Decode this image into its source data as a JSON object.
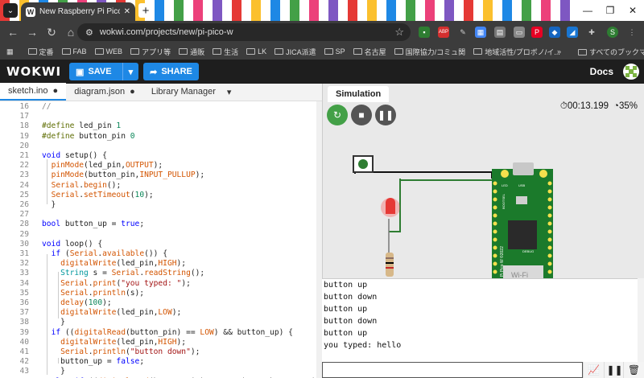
{
  "browser": {
    "tab_title": "New Raspberry Pi Pico W Project",
    "url": "wokwi.com/projects/new/pi-pico-w",
    "bookmarks": [
      "定番",
      "FAB",
      "WEB",
      "アプリ等",
      "通販",
      "生活",
      "LK",
      "JICA派遣",
      "SP",
      "名古屋",
      "国際協力/コミュ関",
      "地域活性/プロボノ/イ..."
    ],
    "bookmarks_more": "»",
    "all_bookmarks": "すべてのブックマーク"
  },
  "wokwi": {
    "logo": "WOKWI",
    "save_label": "SAVE",
    "share_label": "SHARE",
    "docs_label": "Docs"
  },
  "editor": {
    "tabs": [
      "sketch.ino",
      "diagram.json",
      "Library Manager"
    ],
    "lines": [
      {
        "n": "16",
        "t": "//"
      },
      {
        "n": "17",
        "t": ""
      },
      {
        "n": "18",
        "t": "#define led_pin 1"
      },
      {
        "n": "19",
        "t": "#define button_pin 0"
      },
      {
        "n": "20",
        "t": ""
      },
      {
        "n": "21",
        "t": "void setup() {"
      },
      {
        "n": "22",
        "t": "  pinMode(led_pin,OUTPUT);"
      },
      {
        "n": "23",
        "t": "  pinMode(button_pin,INPUT_PULLUP);"
      },
      {
        "n": "24",
        "t": "  Serial.begin();"
      },
      {
        "n": "25",
        "t": "  Serial.setTimeout(10);"
      },
      {
        "n": "26",
        "t": "  }"
      },
      {
        "n": "27",
        "t": ""
      },
      {
        "n": "28",
        "t": "bool button_up = true;"
      },
      {
        "n": "29",
        "t": ""
      },
      {
        "n": "30",
        "t": "void loop() {"
      },
      {
        "n": "31",
        "t": "  if (Serial.available()) {"
      },
      {
        "n": "32",
        "t": "    digitalWrite(led_pin,HIGH);"
      },
      {
        "n": "33",
        "t": "    String s = Serial.readString();"
      },
      {
        "n": "34",
        "t": "    Serial.print(\"you typed: \");"
      },
      {
        "n": "35",
        "t": "    Serial.println(s);"
      },
      {
        "n": "36",
        "t": "    delay(100);"
      },
      {
        "n": "37",
        "t": "    digitalWrite(led_pin,LOW);"
      },
      {
        "n": "38",
        "t": "    }"
      },
      {
        "n": "39",
        "t": "  if ((digitalRead(button_pin) == LOW) && button_up) {"
      },
      {
        "n": "40",
        "t": "    digitalWrite(led_pin,HIGH);"
      },
      {
        "n": "41",
        "t": "    Serial.println(\"button down\");"
      },
      {
        "n": "42",
        "t": "    button_up = false;"
      },
      {
        "n": "43",
        "t": "    }"
      },
      {
        "n": "44",
        "t": "  else if ((digitalRead(button_pin) == HIGH) && !button_up) {"
      }
    ]
  },
  "simulation": {
    "tab_label": "Simulation",
    "time": "00:13.199",
    "speed": "35%",
    "board_labels": {
      "led": "LED",
      "usb": "USB",
      "debug": "DEBUG",
      "bootsel": "BOOTSEL",
      "model": "Pi Pico W ©2022",
      "wifi": "Wi-Fi"
    }
  },
  "serial_monitor": {
    "lines": [
      "button up",
      "button down",
      "button up",
      "button down",
      "button up",
      "you typed: hello"
    ],
    "input_value": ""
  }
}
